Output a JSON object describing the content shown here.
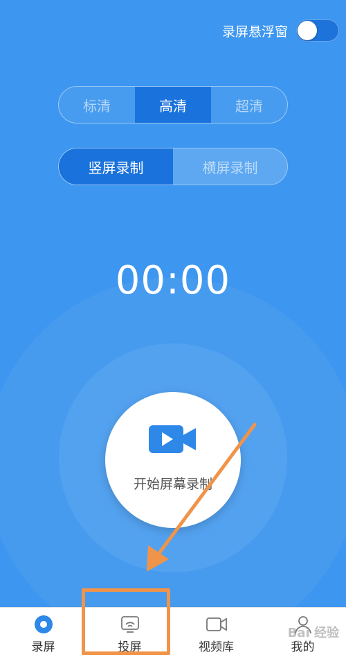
{
  "floating_window": {
    "label": "录屏悬浮窗",
    "enabled": true
  },
  "quality": {
    "options": [
      "标清",
      "高清",
      "超清"
    ],
    "selected": "高清"
  },
  "orientation": {
    "options": [
      "竖屏录制",
      "横屏录制"
    ],
    "selected": "竖屏录制"
  },
  "timer": "00:00",
  "record_button": {
    "label": "开始屏幕录制",
    "icon": "video-camera-icon"
  },
  "tabbar": {
    "items": [
      {
        "label": "录屏",
        "icon": "record-dot-icon",
        "active": true
      },
      {
        "label": "投屏",
        "icon": "cast-screen-icon",
        "active": false
      },
      {
        "label": "视频库",
        "icon": "video-library-icon",
        "active": false
      },
      {
        "label": "我的",
        "icon": "profile-icon",
        "active": false
      }
    ]
  },
  "watermark": "Bai 经验",
  "colors": {
    "primary": "#3d96ef",
    "active_segment": "#1a72dc",
    "annotation": "#f0944a"
  }
}
